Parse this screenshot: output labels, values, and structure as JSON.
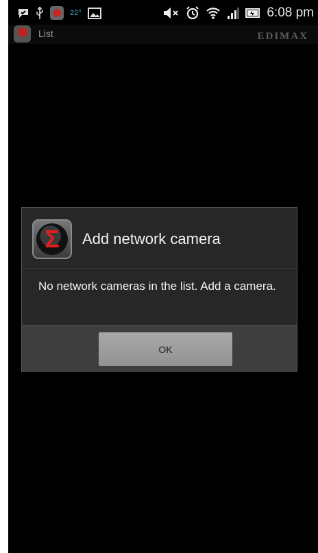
{
  "status_bar": {
    "temperature": "22°",
    "time": "6:08 pm",
    "icons": [
      "chat-icon",
      "usb-icon",
      "app-notification-icon",
      "image-icon",
      "mute-icon",
      "alarm-icon",
      "wifi-icon",
      "signal-icon",
      "battery-icon"
    ]
  },
  "action_bar": {
    "title": "List",
    "brand": "EDIMAX"
  },
  "dialog": {
    "title": "Add network camera",
    "message": "No network cameras in the list. Add a camera.",
    "ok_label": "OK"
  }
}
